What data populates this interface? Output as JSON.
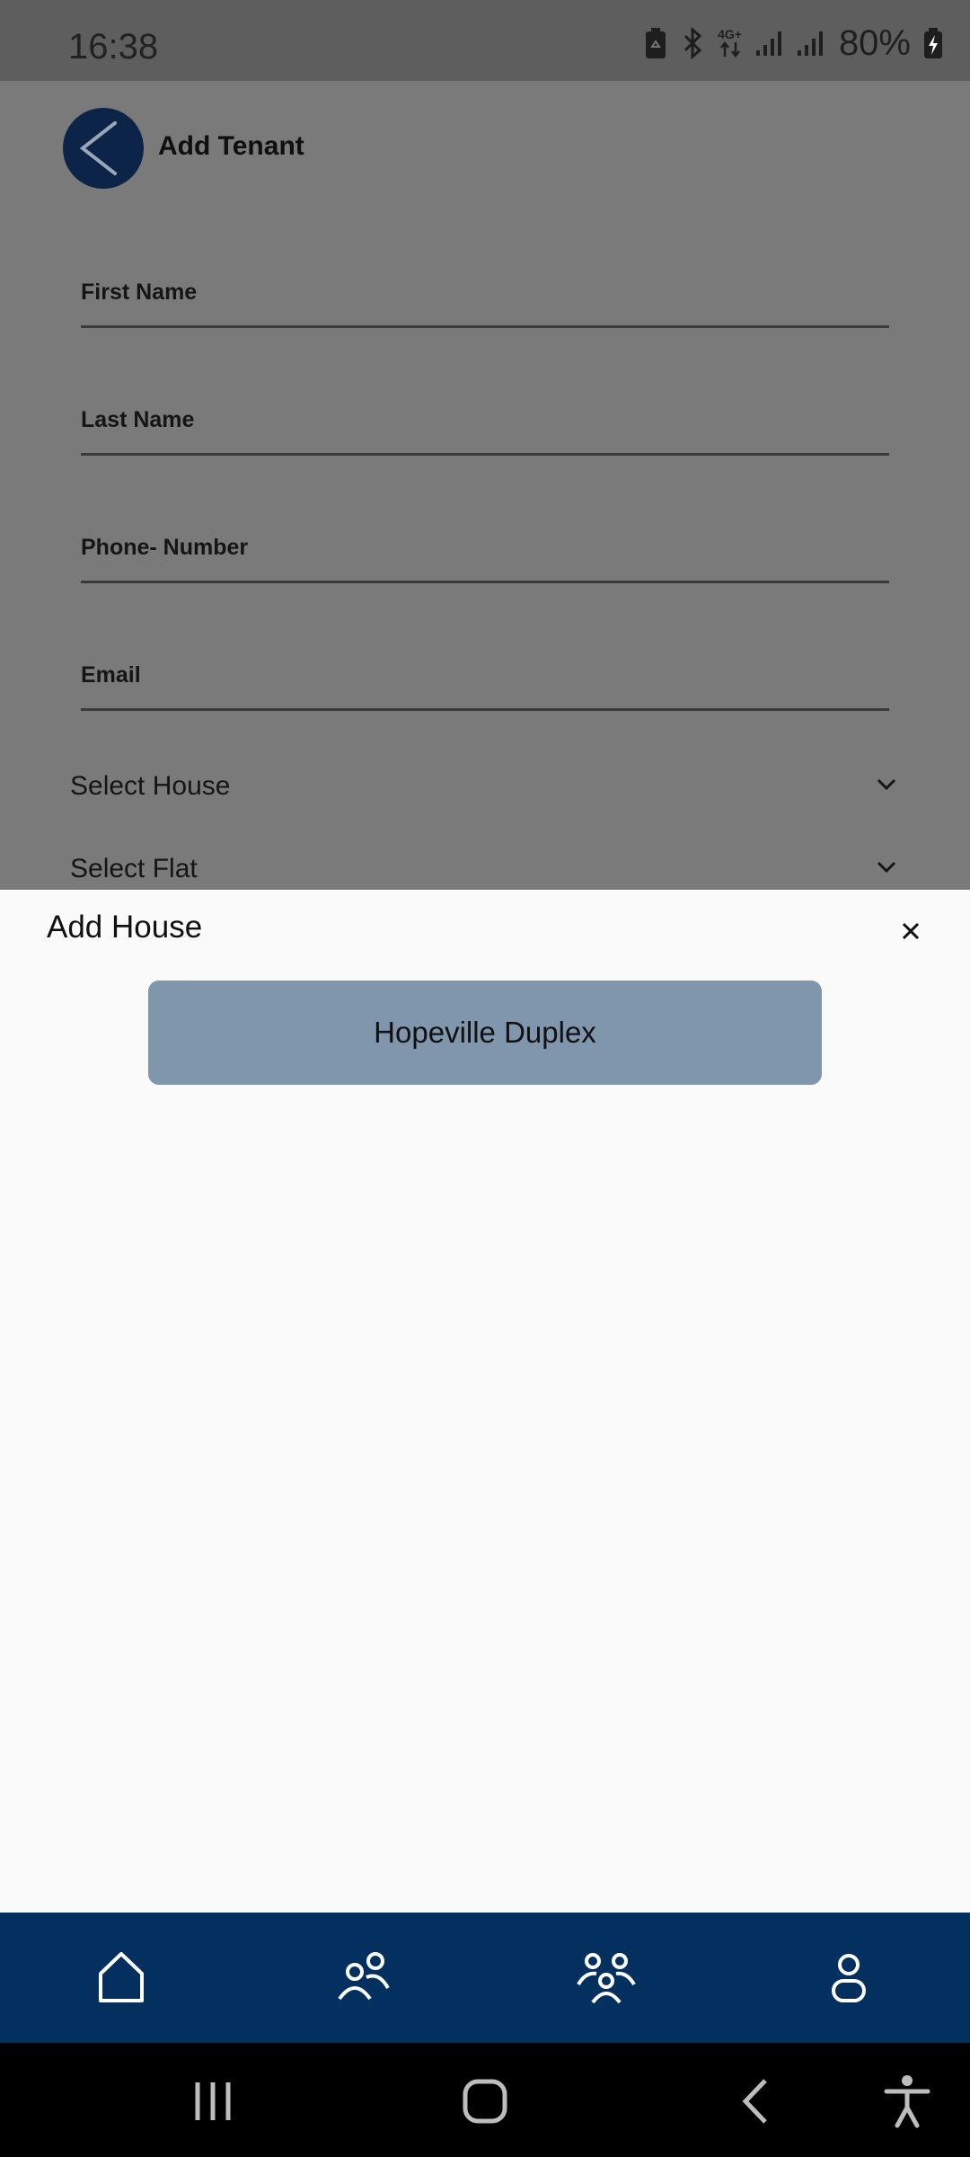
{
  "status_bar": {
    "time": "16:38",
    "network": "4G+",
    "battery": "80%",
    "icons": [
      "battery-saver-icon",
      "bluetooth-icon",
      "network-4g-icon",
      "signal-icon",
      "signal-icon",
      "battery-charging-icon"
    ]
  },
  "header": {
    "title": "Add Tenant",
    "back_icon": "back-arrow-icon"
  },
  "form": {
    "first_name_label": "First Name",
    "last_name_label": "Last Name",
    "phone_label": "Phone- Number",
    "email_label": "Email",
    "select_house": "Select House",
    "select_flat": "Select Flat"
  },
  "sheet": {
    "title": "Add House",
    "close_icon": "close-icon",
    "options": [
      "Hopeville Duplex"
    ]
  },
  "bottom_nav": {
    "items": [
      "home-icon",
      "tenants-icon",
      "group-icon",
      "profile-icon"
    ],
    "color": "#03305f"
  },
  "colors": {
    "accent": "#0b2447",
    "option_bg": "#7f96ad",
    "overlay": "#7a7a7a"
  }
}
